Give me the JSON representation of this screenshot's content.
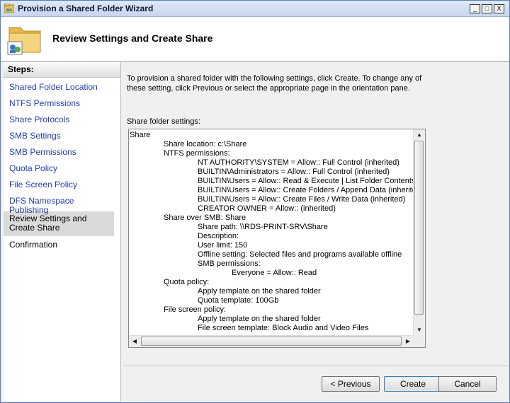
{
  "window": {
    "title": "Provision a Shared Folder Wizard",
    "controls": [
      "_",
      "□",
      "X"
    ]
  },
  "header": {
    "title": "Review Settings and Create Share"
  },
  "steps": {
    "heading": "Steps:",
    "items": [
      {
        "label": "Shared Folder Location"
      },
      {
        "label": "NTFS Permissions"
      },
      {
        "label": "Share Protocols"
      },
      {
        "label": "SMB Settings"
      },
      {
        "label": "SMB Permissions"
      },
      {
        "label": "Quota Policy"
      },
      {
        "label": "File Screen Policy"
      },
      {
        "label": "DFS Namespace Publishing"
      },
      {
        "label": "Review Settings and Create Share"
      },
      {
        "label": "Confirmation"
      }
    ],
    "selected": "Review Settings and Create Share"
  },
  "main": {
    "intro": "To provision a shared folder with the following settings, click Create. To change any of these setting, click Previous or select the appropriate page in the orientation pane.",
    "settings_label": "Share folder settings:",
    "settings_lines": [
      {
        "indent": 0,
        "text": "Share"
      },
      {
        "indent": 1,
        "text": "Share location: c:\\Share"
      },
      {
        "indent": 1,
        "text": "NTFS permissions:"
      },
      {
        "indent": 2,
        "text": "NT AUTHORITY\\SYSTEM = Allow:: Full Control (inherited)"
      },
      {
        "indent": 2,
        "text": "BUILTIN\\Administrators = Allow:: Full Control (inherited)"
      },
      {
        "indent": 2,
        "text": "BUILTIN\\Users = Allow:: Read & Execute | List Folder Contents |"
      },
      {
        "indent": 2,
        "text": "BUILTIN\\Users = Allow:: Create Folders / Append Data (inherited)"
      },
      {
        "indent": 2,
        "text": "BUILTIN\\Users = Allow:: Create Files / Write Data (inherited)"
      },
      {
        "indent": 2,
        "text": "CREATOR OWNER = Allow::  (inherited)"
      },
      {
        "indent": 1,
        "text": "Share over SMB: Share"
      },
      {
        "indent": 2,
        "text": "Share path: \\\\RDS-PRINT-SRV\\Share"
      },
      {
        "indent": 2,
        "text": "Description:"
      },
      {
        "indent": 2,
        "text": "User limit: 150"
      },
      {
        "indent": 2,
        "text": "Offline setting: Selected files and programs available offline"
      },
      {
        "indent": 2,
        "text": "SMB permissions:"
      },
      {
        "indent": 3,
        "text": "Everyone = Allow:: Read"
      },
      {
        "indent": 1,
        "text": "Quota policy:"
      },
      {
        "indent": 2,
        "text": "Apply template on the shared folder"
      },
      {
        "indent": 2,
        "text": "Quota template: 100Gb"
      },
      {
        "indent": 1,
        "text": "File screen policy:"
      },
      {
        "indent": 2,
        "text": "Apply template on the shared folder"
      },
      {
        "indent": 2,
        "text": "File screen template: Block Audio and Video Files"
      }
    ]
  },
  "footer": {
    "previous_label": "< Previous",
    "create_label": "Create",
    "cancel_label": "Cancel"
  },
  "icons": {
    "app": "wizard-folder-icon",
    "header": "shared-folder-icon"
  },
  "colors": {
    "link": "#1f3fa8",
    "selected_step_bg": "#dadada",
    "titlebar": "#c5d6ee"
  }
}
